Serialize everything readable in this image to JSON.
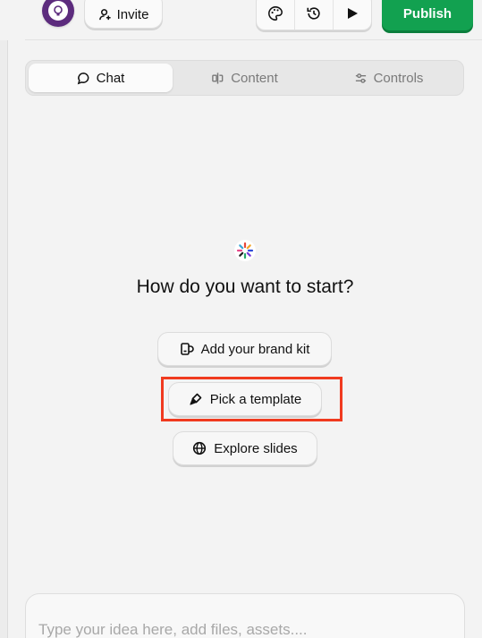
{
  "header": {
    "invite_label": "Invite",
    "publish_label": "Publish",
    "icons": [
      "palette-icon",
      "history-icon",
      "play-icon"
    ]
  },
  "tabs": [
    {
      "label": "Chat",
      "icon": "chat-bubble-icon",
      "active": true
    },
    {
      "label": "Content",
      "icon": "content-icon",
      "active": false
    },
    {
      "label": "Controls",
      "icon": "sliders-icon",
      "active": false
    }
  ],
  "main": {
    "title": "How do you want to start?",
    "options": [
      {
        "label": "Add your brand kit",
        "icon": "brand-kit-icon"
      },
      {
        "label": "Pick a template",
        "icon": "brush-icon"
      },
      {
        "label": "Explore slides",
        "icon": "globe-icon"
      }
    ]
  },
  "composer": {
    "placeholder": "Type your idea here, add files, assets...."
  },
  "colors": {
    "publish": "#12a150",
    "logo": "#5c2b7d",
    "highlight": "#f03a1f",
    "background": "#f3f3f3"
  }
}
